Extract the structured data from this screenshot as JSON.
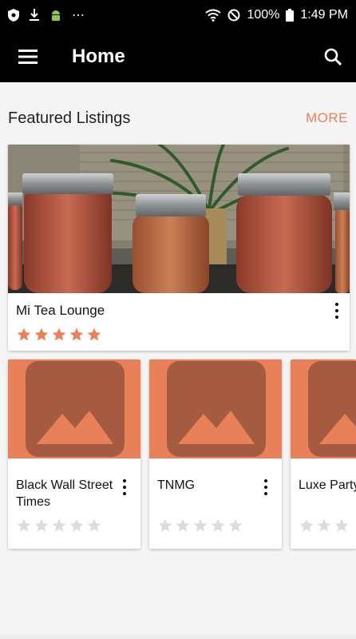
{
  "status": {
    "battery": "100%",
    "time": "1:49 PM",
    "icons_left": [
      "shield-icon",
      "download-icon",
      "android-icon",
      "more-dots-icon"
    ],
    "icons_right": [
      "wifi-icon",
      "do-not-disturb-icon",
      "battery-icon"
    ]
  },
  "appbar": {
    "title": "Home",
    "menu_icon": "hamburger-menu-icon",
    "search_icon": "search-icon"
  },
  "section": {
    "title": "Featured Listings",
    "more_label": "MORE"
  },
  "featured": {
    "title": "Mi Tea Lounge",
    "rating": 5,
    "image": "mason-jars-photo"
  },
  "listings": [
    {
      "title": "Black Wall Street Times",
      "rating": 0
    },
    {
      "title": "TNMG",
      "rating": 0
    },
    {
      "title": "Luxe Party Favors and",
      "rating": 0
    }
  ],
  "colors": {
    "accent": "#e8805a",
    "placeholder_dark": "#a45b40",
    "star_filled": "#e8805a",
    "star_empty": "#dcdcdc"
  }
}
